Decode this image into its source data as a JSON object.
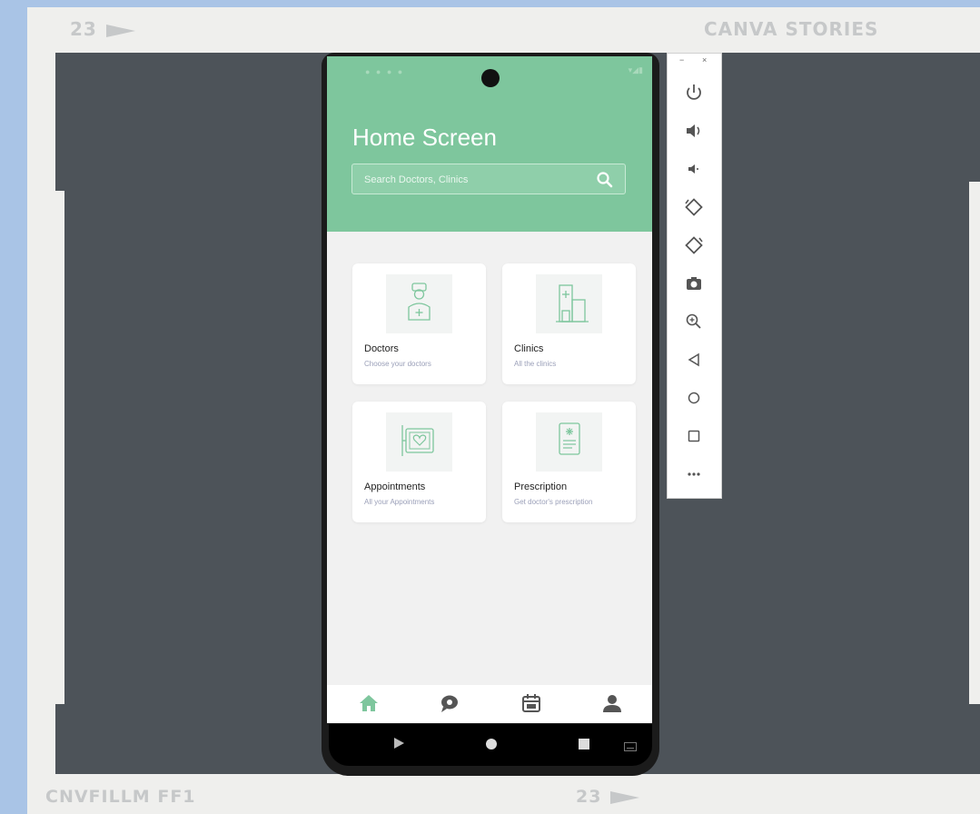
{
  "film": {
    "frame_number": "23",
    "brand": "CANVA STORIES",
    "film_code": "CNVFILLM FF1",
    "frame_number_bottom": "23"
  },
  "app": {
    "title": "Home Screen",
    "search_placeholder": "Search Doctors, Clinics",
    "accent_color": "#7ec69d",
    "categories": [
      {
        "title": "Doctors",
        "subtitle": "Choose your doctors",
        "icon": "doctor-icon"
      },
      {
        "title": "Clinics",
        "subtitle": "All the clinics",
        "icon": "clinic-building-icon"
      },
      {
        "title": "Appointments",
        "subtitle": "All your Appointments",
        "icon": "heart-monitor-icon"
      },
      {
        "title": "Prescription",
        "subtitle": "Get doctor's prescription",
        "icon": "prescription-icon"
      }
    ],
    "bottom_nav": [
      "home-icon",
      "chat-icon",
      "calendar-icon",
      "profile-icon"
    ]
  },
  "emulator_panel": {
    "window_controls": [
      "−",
      "×"
    ],
    "buttons": [
      "power-icon",
      "volume-up-icon",
      "volume-down-icon",
      "rotate-left-icon",
      "rotate-right-icon",
      "camera-icon",
      "zoom-icon",
      "back-icon",
      "home-circle-icon",
      "overview-square-icon",
      "more-icon"
    ]
  }
}
